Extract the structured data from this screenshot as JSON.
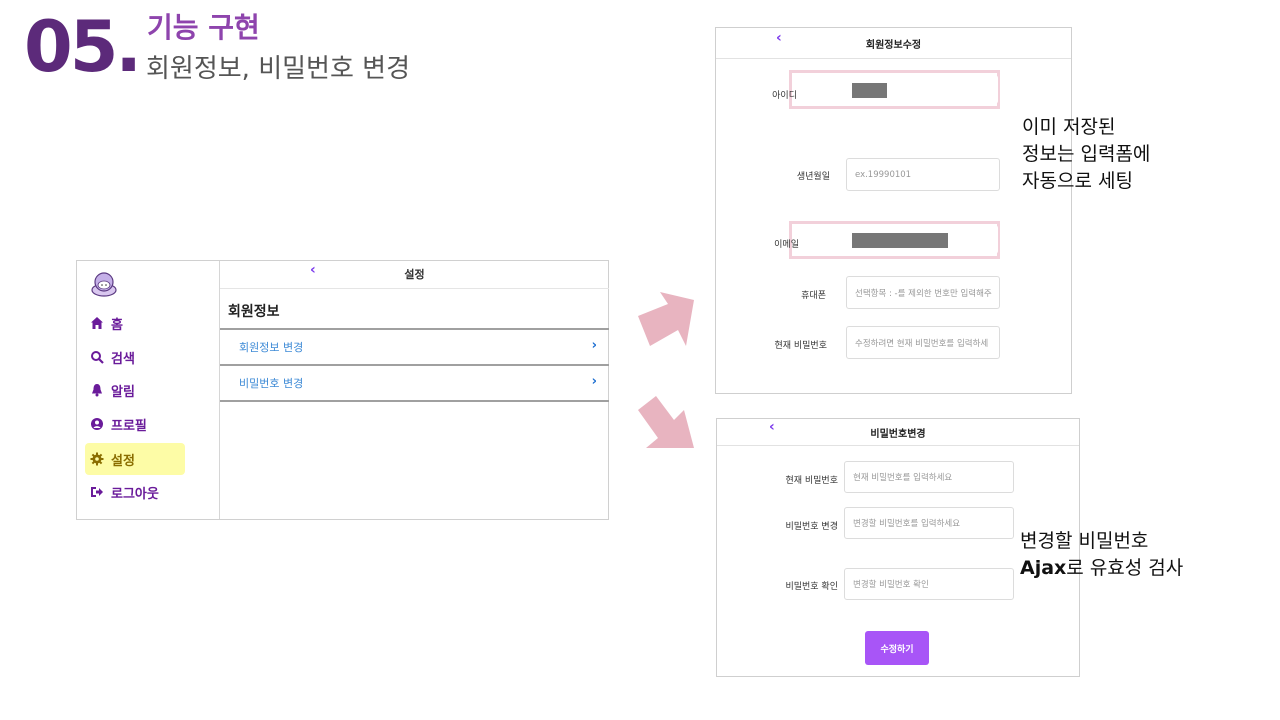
{
  "header": {
    "number": "05.",
    "title": "기능 구현",
    "subtitle": "회원정보, 비밀번호 변경"
  },
  "settings_screen": {
    "title": "설정",
    "back_icon": "chevron-left-icon",
    "nav": [
      {
        "label": "홈",
        "icon": "home-icon"
      },
      {
        "label": "검색",
        "icon": "search-icon"
      },
      {
        "label": "알림",
        "icon": "bell-icon"
      },
      {
        "label": "프로필",
        "icon": "user-circle-icon"
      },
      {
        "label": "설정",
        "icon": "gear-icon",
        "active": true
      },
      {
        "label": "로그아웃",
        "icon": "logout-icon"
      }
    ],
    "section_title": "회원정보",
    "menu": [
      {
        "label": "회원정보 변경"
      },
      {
        "label": "비밀번호 변경"
      }
    ]
  },
  "edit_form": {
    "title": "회원정보수정",
    "fields": {
      "id_label": "아이디",
      "birth_label": "생년월일",
      "birth_placeholder": "ex.19990101",
      "email_label": "이메일",
      "phone_label": "휴대폰",
      "phone_placeholder": "선택항목 : -를 제외한 번호만 입력해주",
      "password_label": "현재 비밀번호",
      "password_placeholder": "수정하려면 현재 비밀번호를 입력하세"
    }
  },
  "password_form": {
    "title": "비밀번호변경",
    "fields": {
      "current_label": "현재 비밀번호",
      "current_placeholder": "현재 비밀번호를 입력하세요",
      "new_label": "비밀번호 변경",
      "new_placeholder": "변경할 비밀번호를 입력하세요",
      "confirm_label": "비밀번호 확인",
      "confirm_placeholder": "변경할 비밀번호 확인"
    },
    "submit_label": "수정하기"
  },
  "notes": {
    "autofill_line1": "이미 저장된",
    "autofill_line2": "정보는 입력폼에",
    "autofill_line3": "자동으로 세팅",
    "ajax_line1": "변경할 비밀번호",
    "ajax_bold": "Ajax",
    "ajax_line2_rest": "로 유효성 검사"
  },
  "colors": {
    "title_purple": "#8e44ad",
    "number_purple": "#5c2a7a",
    "arrow_pink": "#e8b4c0",
    "highlight_pink": "#f2d0da",
    "button_purple": "#a855f7",
    "active_nav_bg": "#fdfca6"
  }
}
